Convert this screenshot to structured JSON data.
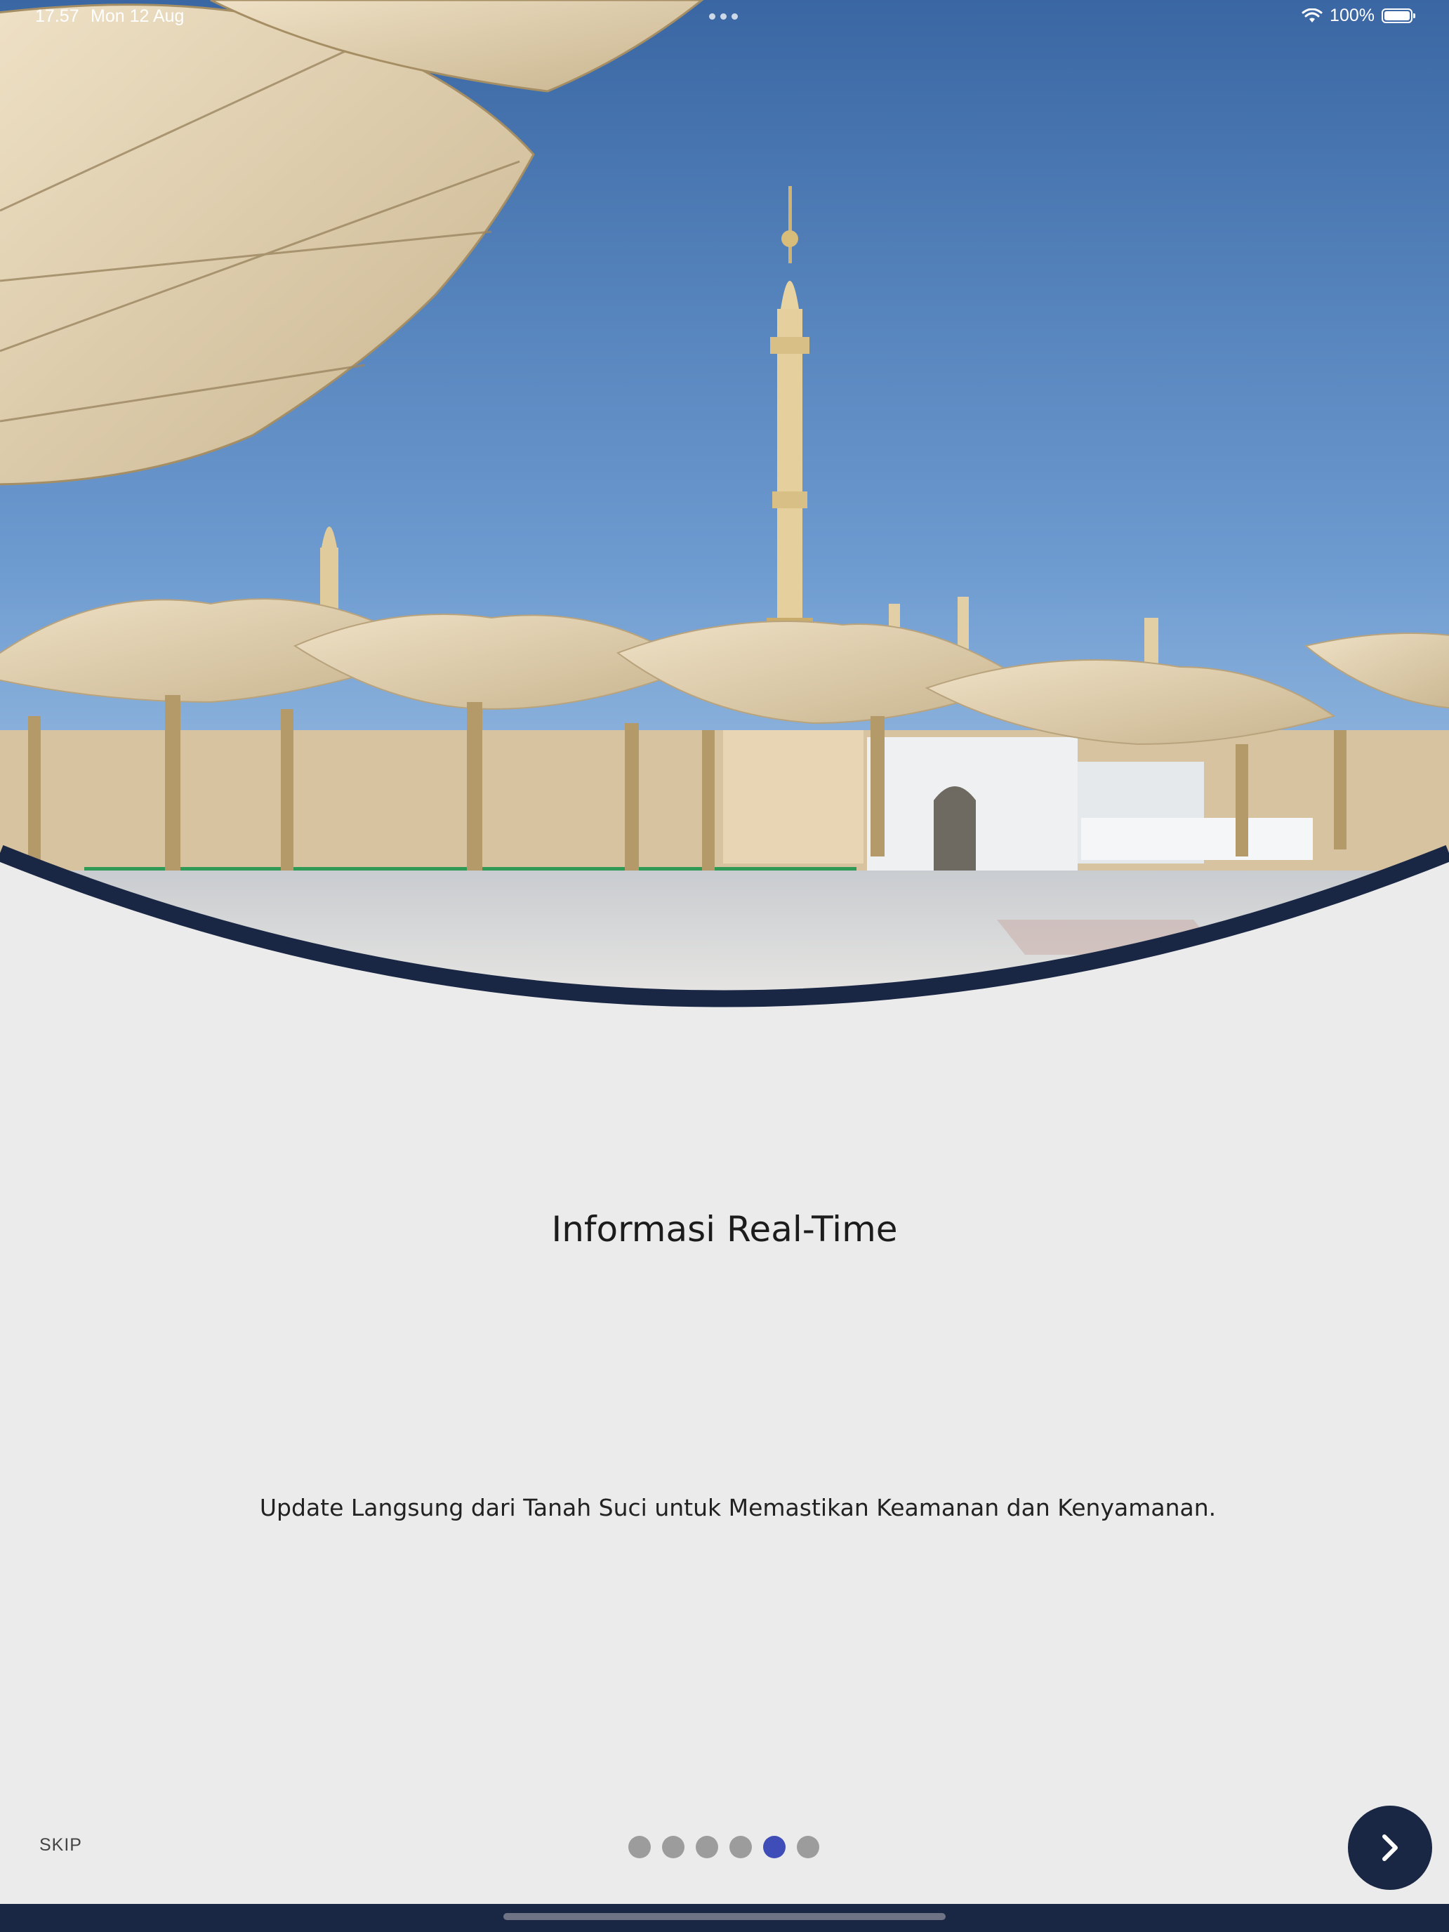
{
  "status_bar": {
    "time": "17.57",
    "date": "Mon 12 Aug",
    "battery": "100%"
  },
  "onboarding": {
    "title": "Informasi Real-Time",
    "description": "Update Langsung dari Tanah Suci untuk Memastikan Keamanan dan Kenyamanan.",
    "skip_label": "SKIP",
    "page_count": 6,
    "current_page": 5
  },
  "colors": {
    "background": "#ebebeb",
    "navy": "#1a2744",
    "dot_active": "#3f4db8",
    "dot_inactive": "#9c9c9c",
    "sky_top": "#3f6ea8",
    "canopy": "#e0cfb0"
  },
  "icons": {
    "hero": "mosque-courtyard-image",
    "wifi": "wifi-icon",
    "battery": "battery-icon",
    "next": "chevron-right-icon"
  }
}
